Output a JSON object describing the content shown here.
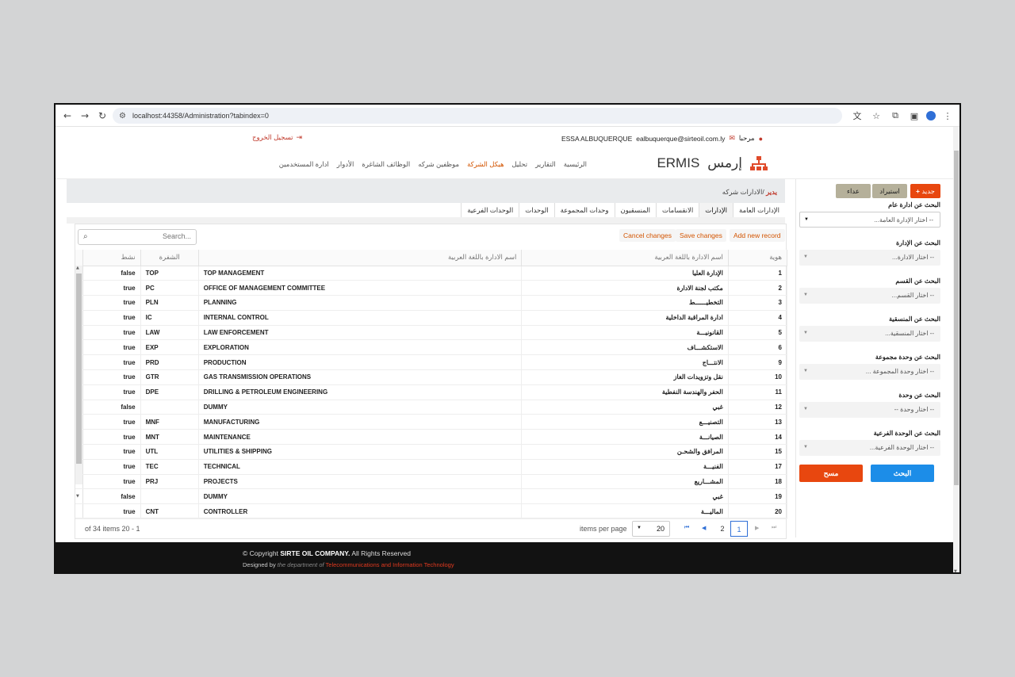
{
  "browser": {
    "url": "localhost:44358/Administration?tabindex=0",
    "back": "←",
    "forward": "→",
    "reload": "↻",
    "tune": "⚙",
    "icons": {
      "translate": "文",
      "star": "☆",
      "ext": "⧉",
      "panel": "▣",
      "profile": "●",
      "more": "⋮"
    }
  },
  "header": {
    "logout_label": "تسجيل الخروج",
    "logout_icon": "⇥",
    "greeting": "مرحبا",
    "user_name": "ESSA ALBUQUERQUE",
    "user_email": "ealbuquerque@sirteoil.com.ly",
    "mail_icon": "✉",
    "user_icon": "👤"
  },
  "brand": {
    "name_ar": "إرمس",
    "name_en": "ERMIS"
  },
  "menu": [
    {
      "label": "الرئيسية",
      "active": false
    },
    {
      "label": "التقارير",
      "active": false
    },
    {
      "label": "تحليل",
      "active": false
    },
    {
      "label": "هيكل الشركة",
      "active": true
    },
    {
      "label": "موظفين شركه",
      "active": false
    },
    {
      "label": "الوظائف الشاغرة",
      "active": false
    },
    {
      "label": "الأدوار",
      "active": false
    },
    {
      "label": "ادارة المستخدمين",
      "active": false
    }
  ],
  "breadcrumb": {
    "root": "يدير",
    "current": "/الادارات شركه"
  },
  "tabs": [
    "الإدارات العامة",
    "الإدارات",
    "الانقسامات",
    "المنسقيون",
    "وحدات المجموعة",
    "الوحدات",
    "الوحدات الفرعية"
  ],
  "active_tab_index": 1,
  "toolbar": {
    "search_placeholder": "Search...",
    "search_icon": "⌕",
    "cancel_label": "Cancel changes",
    "save_label": "Save changes",
    "add_label": "Add new record"
  },
  "grid": {
    "columns": {
      "id": "هوية",
      "name_en": "اسم الادارة باللغة العربية",
      "name_ar": "اسم الادارة باللغة العربية",
      "code": "الشفرة",
      "active": "نشط"
    },
    "column_en_header": "اسم الادارة باللغة العربية",
    "column_ar_header": "اسم الادارة باللغة العربية",
    "rows": [
      {
        "id": "1",
        "ar": "الإدارة العليا",
        "en": "TOP MANAGEMENT",
        "code": "TOP",
        "active": "false"
      },
      {
        "id": "2",
        "ar": "مكتب لجنة الادارة",
        "en": "OFFICE OF MANAGEMENT COMMITTEE",
        "code": "PC",
        "active": "true"
      },
      {
        "id": "3",
        "ar": "التخطيــــــط",
        "en": "PLANNING",
        "code": "PLN",
        "active": "true"
      },
      {
        "id": "4",
        "ar": "ادارة المراقبة الداخلية",
        "en": "INTERNAL CONTROL",
        "code": "IC",
        "active": "true"
      },
      {
        "id": "5",
        "ar": "القانونيـــة",
        "en": "LAW ENFORCEMENT",
        "code": "LAW",
        "active": "true"
      },
      {
        "id": "6",
        "ar": "الاستكشـــاف",
        "en": "EXPLORATION",
        "code": "EXP",
        "active": "true"
      },
      {
        "id": "9",
        "ar": "الانتـــاج",
        "en": "PRODUCTION",
        "code": "PRD",
        "active": "true"
      },
      {
        "id": "10",
        "ar": "نقل وتزويدات الغاز",
        "en": "GAS TRANSMISSION OPERATIONS",
        "code": "GTR",
        "active": "true"
      },
      {
        "id": "11",
        "ar": "الحفر والهندسة النفطية",
        "en": "DRILLING & PETROLEUM ENGINEERING",
        "code": "DPE",
        "active": "true"
      },
      {
        "id": "12",
        "ar": "غبي",
        "en": "DUMMY",
        "code": "",
        "active": "false"
      },
      {
        "id": "13",
        "ar": "التصنيـــع",
        "en": "MANUFACTURING",
        "code": "MNF",
        "active": "true"
      },
      {
        "id": "14",
        "ar": "الصيانـــة",
        "en": "MAINTENANCE",
        "code": "MNT",
        "active": "true"
      },
      {
        "id": "15",
        "ar": "المرافق والشحـن",
        "en": "UTILITIES & SHIPPING",
        "code": "UTL",
        "active": "true"
      },
      {
        "id": "17",
        "ar": "الفنيـــة",
        "en": "TECHNICAL",
        "code": "TEC",
        "active": "true"
      },
      {
        "id": "18",
        "ar": "المشـــاريع",
        "en": "PROJECTS",
        "code": "PRJ",
        "active": "true"
      },
      {
        "id": "19",
        "ar": "غبي",
        "en": "DUMMY",
        "code": "",
        "active": "false"
      },
      {
        "id": "20",
        "ar": "الماليـــة",
        "en": "CONTROLLER",
        "code": "CNT",
        "active": "true"
      }
    ]
  },
  "pager": {
    "info": "of 34 items 20 - 1",
    "items_per_page_label": "items per page",
    "page_size": "20",
    "pages": [
      "2",
      "1"
    ],
    "current_page": "1",
    "first": "⏮",
    "prev": "◀",
    "next": "▶",
    "last": "⏭"
  },
  "sidebar": {
    "new_label": "جديد",
    "new_icon": "+",
    "import_label": "استيراد",
    "cancel_label": "عداء",
    "filters": [
      {
        "label": "البحث عن ادارة عام",
        "value": "-- اختار الإدارة العامة..."
      },
      {
        "label": "البحث عن الإدارة",
        "value": "-- اختار الادارة..."
      },
      {
        "label": "البحث عن القسم",
        "value": "-- اختار القسم..."
      },
      {
        "label": "البحث عن المنسقية",
        "value": "-- اختار المنسقية..."
      },
      {
        "label": "البحث عن وحدة مجموعة",
        "value": "-- اختار وحدة المجموعة ..."
      },
      {
        "label": "البحث عن وحدة",
        "value": "-- اختار وحدة --"
      },
      {
        "label": "البحث عن الوحدة الفرعية",
        "value": "-- اختار الوحدة الفرعية..."
      }
    ],
    "clear_label": "مسح",
    "search_label": "البحث"
  },
  "footer": {
    "copyright": "© Copyright",
    "company": "SIRTE OIL COMPANY.",
    "rights": "All Rights Reserved",
    "designed_by": "Designed by",
    "dept_prefix": "the department of",
    "dept": "Telecommunications and Information Technology"
  }
}
